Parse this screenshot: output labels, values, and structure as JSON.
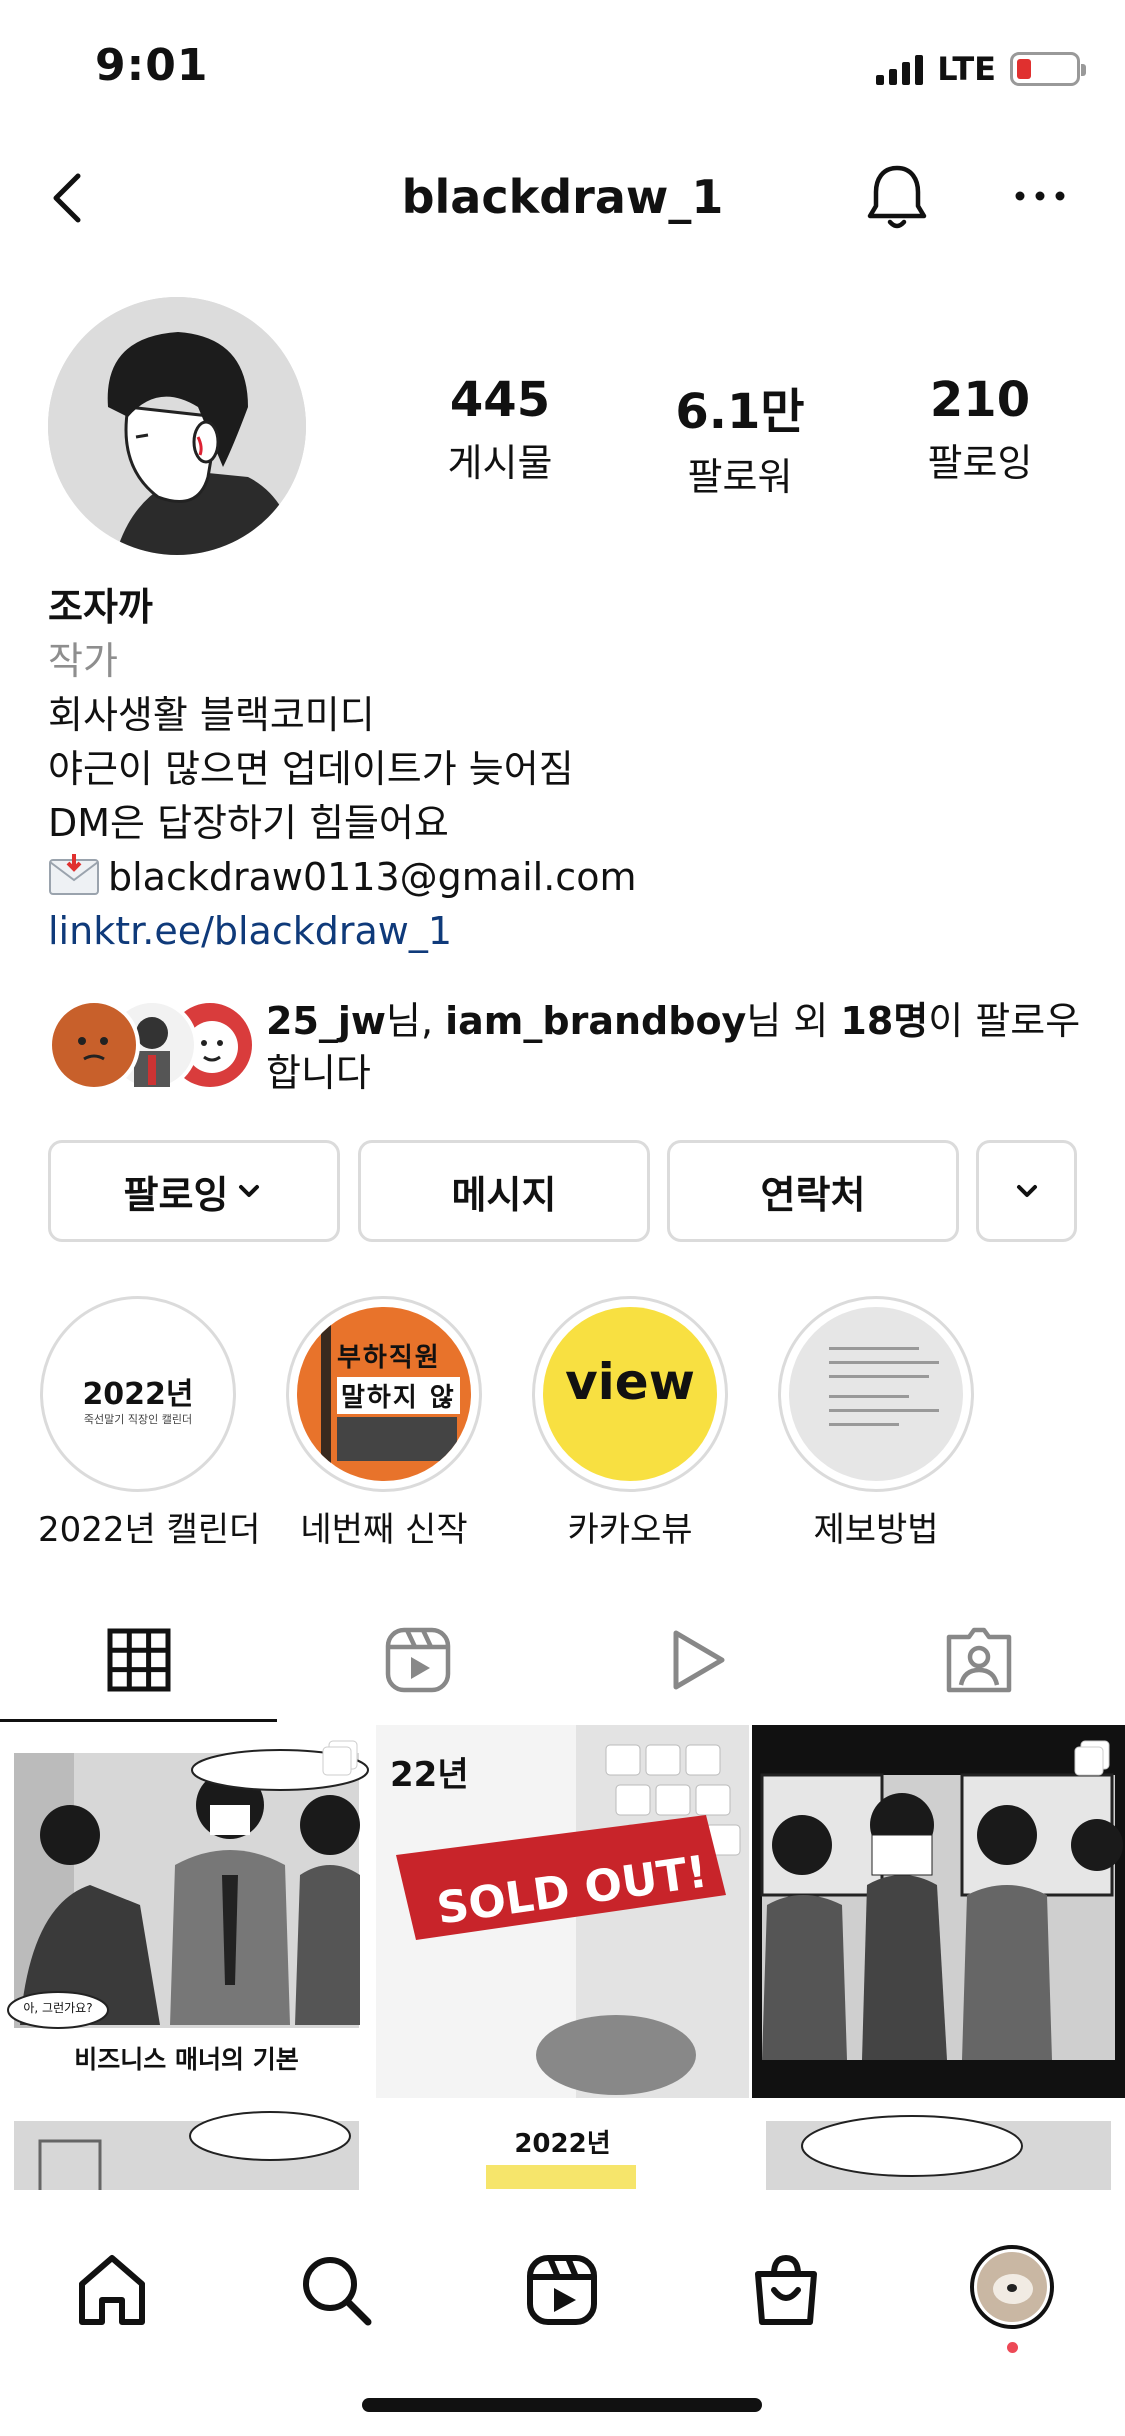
{
  "status": {
    "time": "9:01",
    "network": "LTE"
  },
  "profile": {
    "username": "blackdraw_1",
    "stats": [
      {
        "value": "445",
        "label": "게시물"
      },
      {
        "value": "6.1만",
        "label": "팔로워"
      },
      {
        "value": "210",
        "label": "팔로잉"
      }
    ],
    "name": "조자까",
    "category": "작가",
    "bio_lines": [
      "회사생활 블랙코미디",
      "야근이 많으면 업데이트가 늦어짐",
      "DM은 답장하기 힘들어요"
    ],
    "email": "blackdraw0113@gmail.com",
    "link": "linktr.ee/blackdraw_1"
  },
  "followed_by": {
    "user1": "25_jw",
    "suffix1": "님, ",
    "user2": "iam_brandboy",
    "suffix2": "님 외 ",
    "count": "18명",
    "suffix3": "이 팔로우",
    "line2": "합니다"
  },
  "actions": {
    "following": "팔로잉",
    "message": "메시지",
    "contact": "연락처"
  },
  "highlights": [
    {
      "label": "2022년 캘린더",
      "cover_title": "2022년",
      "cover_sub": "죽선말기 직장인 캘린더"
    },
    {
      "label": "네번째 신작",
      "cover_title": "부하직원",
      "cover_sub": "말하지 않"
    },
    {
      "label": "카카오뷰",
      "cover_title": "view"
    },
    {
      "label": "제보방법"
    }
  ],
  "posts": [
    {
      "caption": "비즈니스 매너의 기본",
      "bubble1": "아, 그런가요?"
    },
    {
      "caption": "SOLD OUT!",
      "cover": "22년"
    },
    {
      "caption": ""
    },
    {
      "caption": ""
    },
    {
      "caption": "2022년"
    },
    {
      "caption": ""
    }
  ],
  "colors": {
    "link": "#0f3a7a",
    "notification_dot": "#ed4956",
    "kakao_yellow": "#f8e041"
  }
}
